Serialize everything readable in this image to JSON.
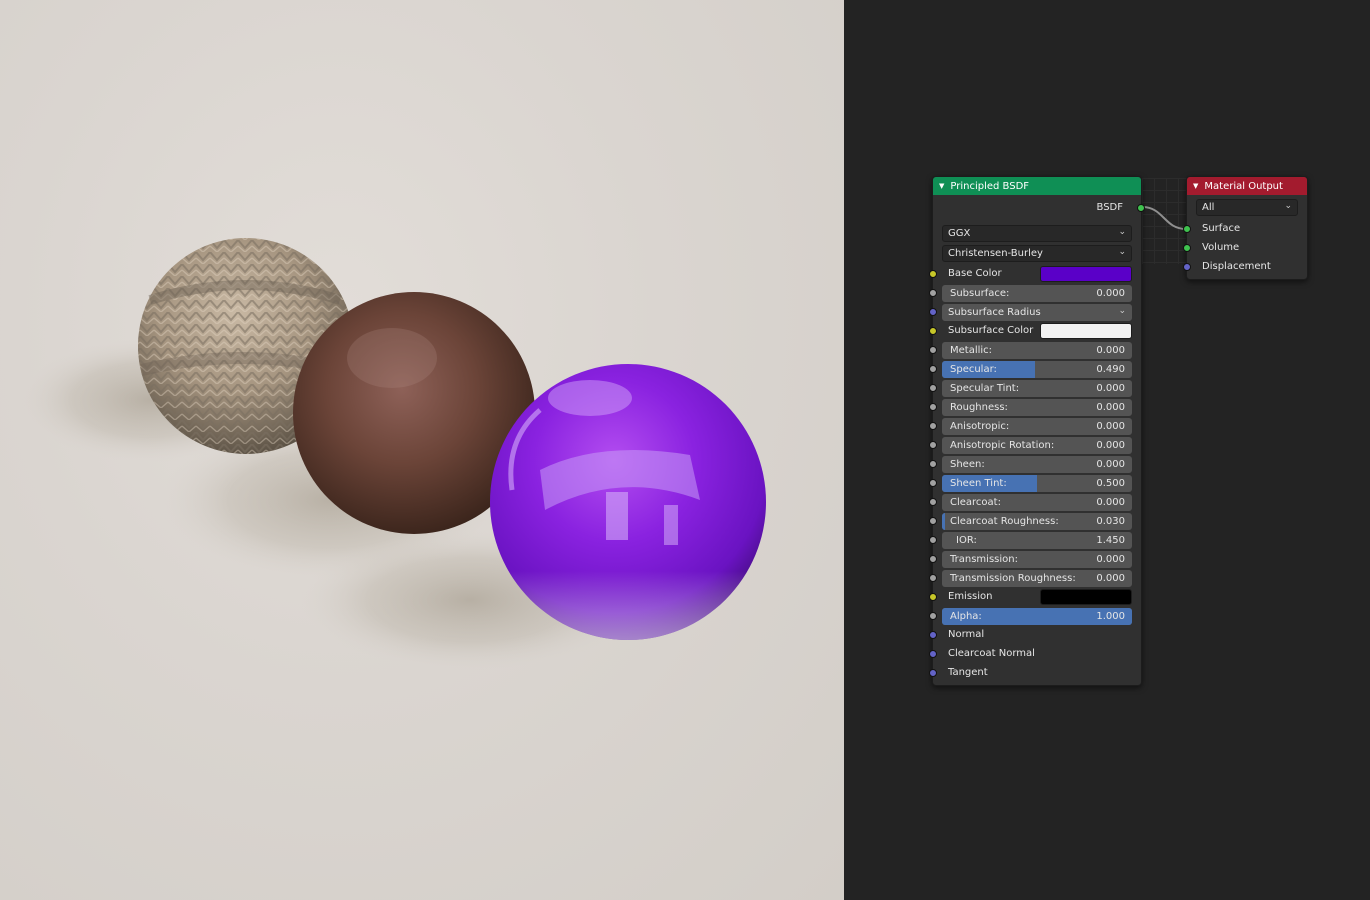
{
  "render": {
    "spheres": [
      "knit-wool-sphere",
      "leather-sphere",
      "glossy-purple-sphere"
    ]
  },
  "colors": {
    "bsdf_header": "#0f8f55",
    "output_header": "#a31b2e",
    "base_color": "#5a00c8",
    "subsurface_color": "#f2f2f2",
    "emission": "#000000",
    "slider_fill": "#4772b3"
  },
  "bsdf_node": {
    "title": "Principled BSDF",
    "output_label": "BSDF",
    "distribution": "GGX",
    "subsurface_method": "Christensen-Burley",
    "base_color_label": "Base Color",
    "subsurface": {
      "label": "Subsurface:",
      "value": "0.000",
      "fraction": 0
    },
    "subsurface_radius": "Subsurface Radius",
    "subsurface_color_label": "Subsurface Color",
    "metallic": {
      "label": "Metallic:",
      "value": "0.000",
      "fraction": 0
    },
    "specular": {
      "label": "Specular:",
      "value": "0.490",
      "fraction": 0.49
    },
    "specular_tint": {
      "label": "Specular Tint:",
      "value": "0.000",
      "fraction": 0
    },
    "roughness": {
      "label": "Roughness:",
      "value": "0.000",
      "fraction": 0
    },
    "anisotropic": {
      "label": "Anisotropic:",
      "value": "0.000",
      "fraction": 0
    },
    "anisotropic_rotation": {
      "label": "Anisotropic Rotation:",
      "value": "0.000",
      "fraction": 0
    },
    "sheen": {
      "label": "Sheen:",
      "value": "0.000",
      "fraction": 0
    },
    "sheen_tint": {
      "label": "Sheen Tint:",
      "value": "0.500",
      "fraction": 0.5
    },
    "clearcoat": {
      "label": "Clearcoat:",
      "value": "0.000",
      "fraction": 0
    },
    "clearcoat_roughness": {
      "label": "Clearcoat Roughness:",
      "value": "0.030",
      "fraction": 0.03
    },
    "ior": {
      "label": "IOR:",
      "value": "1.450",
      "fraction": 0
    },
    "transmission": {
      "label": "Transmission:",
      "value": "0.000",
      "fraction": 0
    },
    "transmission_roughness": {
      "label": "Transmission Roughness:",
      "value": "0.000",
      "fraction": 0
    },
    "emission_label": "Emission",
    "alpha": {
      "label": "Alpha:",
      "value": "1.000",
      "fraction": 1
    },
    "normal_label": "Normal",
    "clearcoat_normal_label": "Clearcoat Normal",
    "tangent_label": "Tangent"
  },
  "output_node": {
    "title": "Material Output",
    "target": "All",
    "surface_label": "Surface",
    "volume_label": "Volume",
    "displacement_label": "Displacement"
  }
}
